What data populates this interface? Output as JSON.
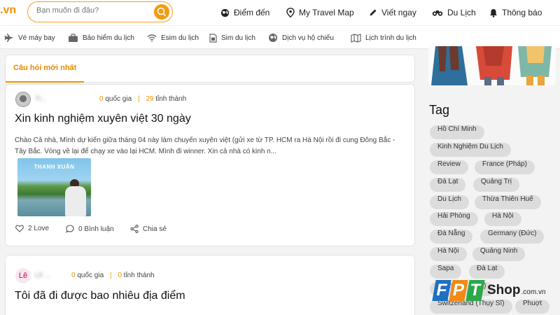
{
  "header": {
    "logo_text": ".vn",
    "search_placeholder": "Bạn muốn đi đâu?",
    "nav": [
      {
        "label": "Điểm đến",
        "icon": "globe-icon"
      },
      {
        "label": "My Travel Map",
        "icon": "map-pin-icon"
      },
      {
        "label": "Viết ngay",
        "icon": "pencil-icon"
      },
      {
        "label": "Du Lịch",
        "icon": "binoculars-icon"
      },
      {
        "label": "Thông báo",
        "icon": "bell-icon"
      }
    ]
  },
  "subnav": [
    {
      "label": "Vé máy bay",
      "icon": "airplane-icon"
    },
    {
      "label": "Bảo hiểm du lịch",
      "icon": "briefcase-icon"
    },
    {
      "label": "Esim du lịch",
      "icon": "wifi-icon"
    },
    {
      "label": "Sim du lịch",
      "icon": "sim-card-icon"
    },
    {
      "label": "Dịch vụ hộ chiếu",
      "icon": "globe-icon"
    },
    {
      "label": "Lịch trình du lịch",
      "icon": "map-icon"
    }
  ],
  "tabs": {
    "active": "Câu hỏi mới nhất"
  },
  "posts": [
    {
      "avatar_text": "",
      "username": "Tr...",
      "countries": "0",
      "countries_label": "quốc gia",
      "provinces": "29",
      "provinces_label": "tỉnh thành",
      "title": "Xin kinh nghiệm xuyên việt 30 ngày",
      "excerpt": "Chào Cả nhà, Mình dự kiến giữa tháng 04 này làm chuyến xuyên việt (gửi xe từ TP. HCM ra Hà Nội rồi đi cung Đông Bắc - Tây Bắc. Vòng về lại để chạy xe vào lại HCM. Mình đi winner. Xin cả nhà có kinh n...",
      "image_caption": "THANH XUÂN",
      "likes": "2 Love",
      "comments": "0 Bình luận",
      "share": "Chia sẻ"
    },
    {
      "avatar_text": "Lê",
      "username": "Lê ...",
      "countries": "0",
      "countries_label": "quốc gia",
      "provinces": "0",
      "provinces_label": "tỉnh thành",
      "title": "Tôi đã đi được bao nhiêu địa điểm"
    }
  ],
  "sidebar": {
    "tag_heading": "Tag",
    "tags": [
      "Hồ Chí Minh",
      "Kinh Nghiệm Du Lịch",
      "Review",
      "France (Pháp)",
      "Đà Lạt",
      "Quảng Trị",
      "Du Lịch",
      "Thừa Thiên Huế",
      "Hải Phòng",
      "Hà Nội",
      "Đà Nẵng",
      "Germany (Đức)",
      "Hà Nội",
      "Quảng Ninh",
      "Sapa",
      "Đà Lạt",
      "Germany (Đức)",
      "Switzerland (Thụy Sĩ)",
      "Phuợt"
    ]
  },
  "watermark": {
    "brand": "FPT",
    "shop": "Shop",
    "domain": ".com.vn"
  },
  "colors": {
    "accent": "#f39200",
    "chip": "#dcdcdc"
  }
}
